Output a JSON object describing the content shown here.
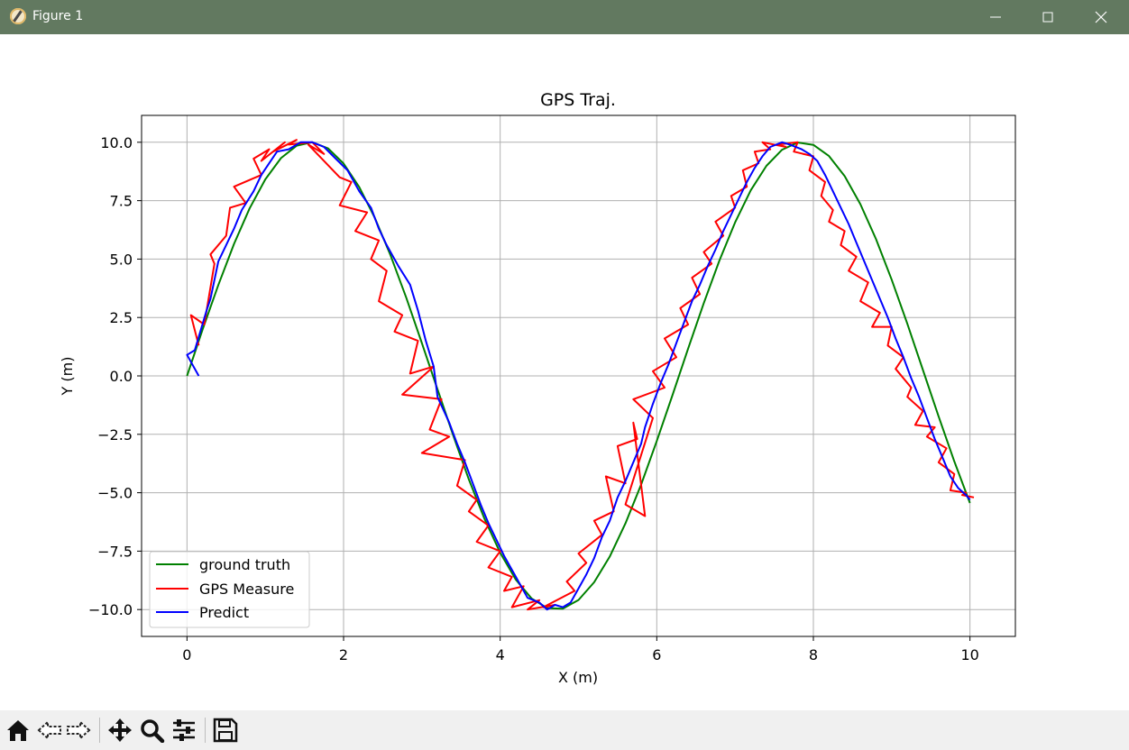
{
  "window": {
    "title": "Figure 1",
    "controls": [
      "minimize-icon",
      "maximize-icon",
      "close-icon"
    ]
  },
  "toolbar": {
    "buttons": [
      "home-icon",
      "back-arrow-icon",
      "forward-arrow-icon",
      "pan-icon",
      "zoom-icon",
      "configure-subplots-icon",
      "save-icon"
    ]
  },
  "chart_data": {
    "type": "line",
    "title": "GPS Traj.",
    "xlabel": "X (m)",
    "ylabel": "Y (m)",
    "xlim": [
      -0.58,
      10.58
    ],
    "ylim": [
      -11.15,
      11.15
    ],
    "x_ticks": [
      "0",
      "2",
      "4",
      "6",
      "8",
      "10"
    ],
    "y_ticks": [
      "10.0",
      "7.5",
      "5.0",
      "2.5",
      "0.0",
      "−2.5",
      "−5.0",
      "−7.5",
      "−10.0"
    ],
    "grid": true,
    "legend_position": "lower-left",
    "series": [
      {
        "name": "ground truth",
        "color": "#008000",
        "x": [
          0,
          0.2,
          0.4,
          0.6,
          0.8,
          1.0,
          1.2,
          1.4,
          1.6,
          1.8,
          2.0,
          2.2,
          2.4,
          2.6,
          2.8,
          3.0,
          3.2,
          3.4,
          3.6,
          3.8,
          4.0,
          4.2,
          4.4,
          4.6,
          4.8,
          5.0,
          5.2,
          5.4,
          5.6,
          5.8,
          6.0,
          6.2,
          6.4,
          6.6,
          6.8,
          7.0,
          7.2,
          7.4,
          7.6,
          7.8,
          8.0,
          8.2,
          8.4,
          8.6,
          8.8,
          9.0,
          9.2,
          9.4,
          9.6,
          9.8,
          10.0
        ],
        "y": [
          0,
          1.99,
          3.89,
          5.65,
          7.17,
          8.41,
          9.32,
          9.85,
          10.0,
          9.74,
          9.09,
          8.08,
          6.76,
          5.16,
          3.35,
          1.41,
          -0.58,
          -2.55,
          -4.43,
          -6.12,
          -7.57,
          -8.72,
          -9.52,
          -9.94,
          -9.96,
          -9.59,
          -8.83,
          -7.73,
          -6.31,
          -4.65,
          -2.79,
          -0.83,
          1.17,
          3.11,
          4.94,
          6.57,
          7.94,
          8.99,
          9.68,
          9.99,
          9.89,
          9.41,
          8.55,
          7.35,
          5.86,
          4.12,
          2.23,
          0.25,
          -1.74,
          -3.66,
          -5.44
        ]
      },
      {
        "name": "GPS Measure",
        "color": "#ff0000",
        "x": [
          0.15,
          0.05,
          0.22,
          0.35,
          0.3,
          0.5,
          0.55,
          0.75,
          0.6,
          0.95,
          0.85,
          1.05,
          0.95,
          1.25,
          1.1,
          1.4,
          1.3,
          1.6,
          1.75,
          1.55,
          1.95,
          2.1,
          1.95,
          2.3,
          2.15,
          2.45,
          2.35,
          2.55,
          2.45,
          2.75,
          2.65,
          2.95,
          2.85,
          3.15,
          2.75,
          3.25,
          3.1,
          3.35,
          3.0,
          3.55,
          3.45,
          3.7,
          3.6,
          3.85,
          3.7,
          4.0,
          3.85,
          4.15,
          4.05,
          4.3,
          4.15,
          4.5,
          4.35,
          4.7,
          4.55,
          4.95,
          4.85,
          5.1,
          5.0,
          5.3,
          5.2,
          5.45,
          5.35,
          5.6,
          5.5,
          5.75,
          5.7,
          5.85,
          5.6,
          5.95,
          5.7,
          6.1,
          5.95,
          6.25,
          6.1,
          6.4,
          6.3,
          6.55,
          6.45,
          6.7,
          6.6,
          6.85,
          6.75,
          7.0,
          6.95,
          7.15,
          7.1,
          7.3,
          7.25,
          7.45,
          7.35,
          7.65,
          7.55,
          7.8,
          7.75,
          8.0,
          7.95,
          8.15,
          8.1,
          8.25,
          8.2,
          8.4,
          8.35,
          8.55,
          8.45,
          8.7,
          8.6,
          8.85,
          8.75,
          9.0,
          8.95,
          9.15,
          9.05,
          9.25,
          9.2,
          9.4,
          9.3,
          9.55,
          9.45,
          9.7,
          9.6,
          9.8,
          9.75,
          9.95,
          9.9,
          10.05
        ],
        "y": [
          1.3,
          2.6,
          2.2,
          4.8,
          5.2,
          6.0,
          7.2,
          7.4,
          8.1,
          8.6,
          9.3,
          9.7,
          9.2,
          10.0,
          9.6,
          10.1,
          9.9,
          10.0,
          9.5,
          9.9,
          8.5,
          8.3,
          7.3,
          7.0,
          6.2,
          5.8,
          5.0,
          4.5,
          3.2,
          2.6,
          1.9,
          1.5,
          0.1,
          0.4,
          -0.8,
          -1.0,
          -2.3,
          -2.6,
          -3.3,
          -3.6,
          -4.7,
          -5.3,
          -5.8,
          -6.4,
          -7.1,
          -7.5,
          -8.2,
          -8.6,
          -9.2,
          -9.0,
          -9.9,
          -9.6,
          -10.0,
          -9.8,
          -9.9,
          -9.2,
          -8.8,
          -8.0,
          -7.6,
          -6.8,
          -6.2,
          -5.8,
          -4.3,
          -4.6,
          -3.0,
          -2.7,
          -2.0,
          -6.0,
          -5.5,
          -1.8,
          -1.0,
          -0.5,
          0.2,
          0.8,
          1.6,
          2.2,
          2.9,
          3.5,
          4.2,
          4.8,
          5.3,
          6.0,
          6.6,
          7.2,
          7.7,
          8.1,
          8.8,
          9.1,
          9.6,
          9.7,
          10.0,
          9.8,
          9.9,
          10.0,
          9.6,
          9.4,
          8.8,
          8.3,
          7.7,
          7.1,
          6.6,
          6.2,
          5.6,
          5.1,
          4.5,
          4.0,
          3.2,
          2.7,
          2.1,
          2.1,
          1.3,
          0.8,
          0.3,
          -0.5,
          -0.9,
          -1.5,
          -2.1,
          -2.2,
          -2.6,
          -3.1,
          -3.7,
          -4.2,
          -4.9,
          -5.0,
          -5.1,
          -5.2
        ]
      },
      {
        "name": "Predict",
        "color": "#0000ff",
        "x": [
          0.15,
          0.0,
          0.1,
          0.25,
          0.3,
          0.4,
          0.5,
          0.6,
          0.7,
          0.85,
          0.95,
          1.05,
          1.15,
          1.3,
          1.45,
          1.6,
          1.75,
          1.9,
          2.05,
          2.2,
          2.35,
          2.45,
          2.55,
          2.7,
          2.85,
          2.95,
          3.05,
          3.15,
          3.2,
          3.35,
          3.45,
          3.55,
          3.65,
          3.75,
          3.85,
          3.95,
          4.05,
          4.15,
          4.25,
          4.35,
          4.5,
          4.6,
          4.7,
          4.8,
          4.9,
          5.0,
          5.1,
          5.2,
          5.3,
          5.4,
          5.5,
          5.6,
          5.7,
          5.8,
          5.85,
          5.95,
          6.05,
          6.15,
          6.25,
          6.35,
          6.45,
          6.55,
          6.65,
          6.75,
          6.85,
          6.95,
          7.05,
          7.15,
          7.25,
          7.35,
          7.45,
          7.6,
          7.7,
          7.85,
          7.95,
          8.05,
          8.15,
          8.25,
          8.35,
          8.45,
          8.55,
          8.65,
          8.75,
          8.85,
          8.95,
          9.05,
          9.15,
          9.25,
          9.35,
          9.45,
          9.55,
          9.65,
          9.75,
          9.85,
          9.95,
          10.0
        ],
        "y": [
          0.0,
          0.9,
          1.1,
          2.8,
          3.3,
          4.9,
          5.6,
          6.3,
          7.1,
          7.9,
          8.6,
          9.1,
          9.6,
          9.7,
          10.0,
          10.0,
          9.8,
          9.3,
          8.8,
          7.9,
          7.2,
          6.3,
          5.6,
          4.7,
          3.9,
          2.8,
          1.5,
          0.4,
          -0.9,
          -2.0,
          -2.9,
          -3.7,
          -4.6,
          -5.5,
          -6.3,
          -7.0,
          -7.7,
          -8.3,
          -8.9,
          -9.5,
          -9.7,
          -10.0,
          -9.8,
          -9.9,
          -9.7,
          -9.1,
          -8.5,
          -7.8,
          -6.9,
          -6.2,
          -5.2,
          -4.5,
          -3.7,
          -2.9,
          -2.2,
          -1.2,
          -0.3,
          0.5,
          1.4,
          2.3,
          3.2,
          3.9,
          4.7,
          5.4,
          6.2,
          6.9,
          7.6,
          8.3,
          8.9,
          9.4,
          9.8,
          10.0,
          9.9,
          9.7,
          9.5,
          9.2,
          8.6,
          7.9,
          7.2,
          6.5,
          5.7,
          4.9,
          4.1,
          3.3,
          2.5,
          1.6,
          0.8,
          -0.1,
          -0.9,
          -1.8,
          -2.7,
          -3.5,
          -4.3,
          -4.8,
          -5.1,
          -5.3
        ]
      }
    ]
  }
}
